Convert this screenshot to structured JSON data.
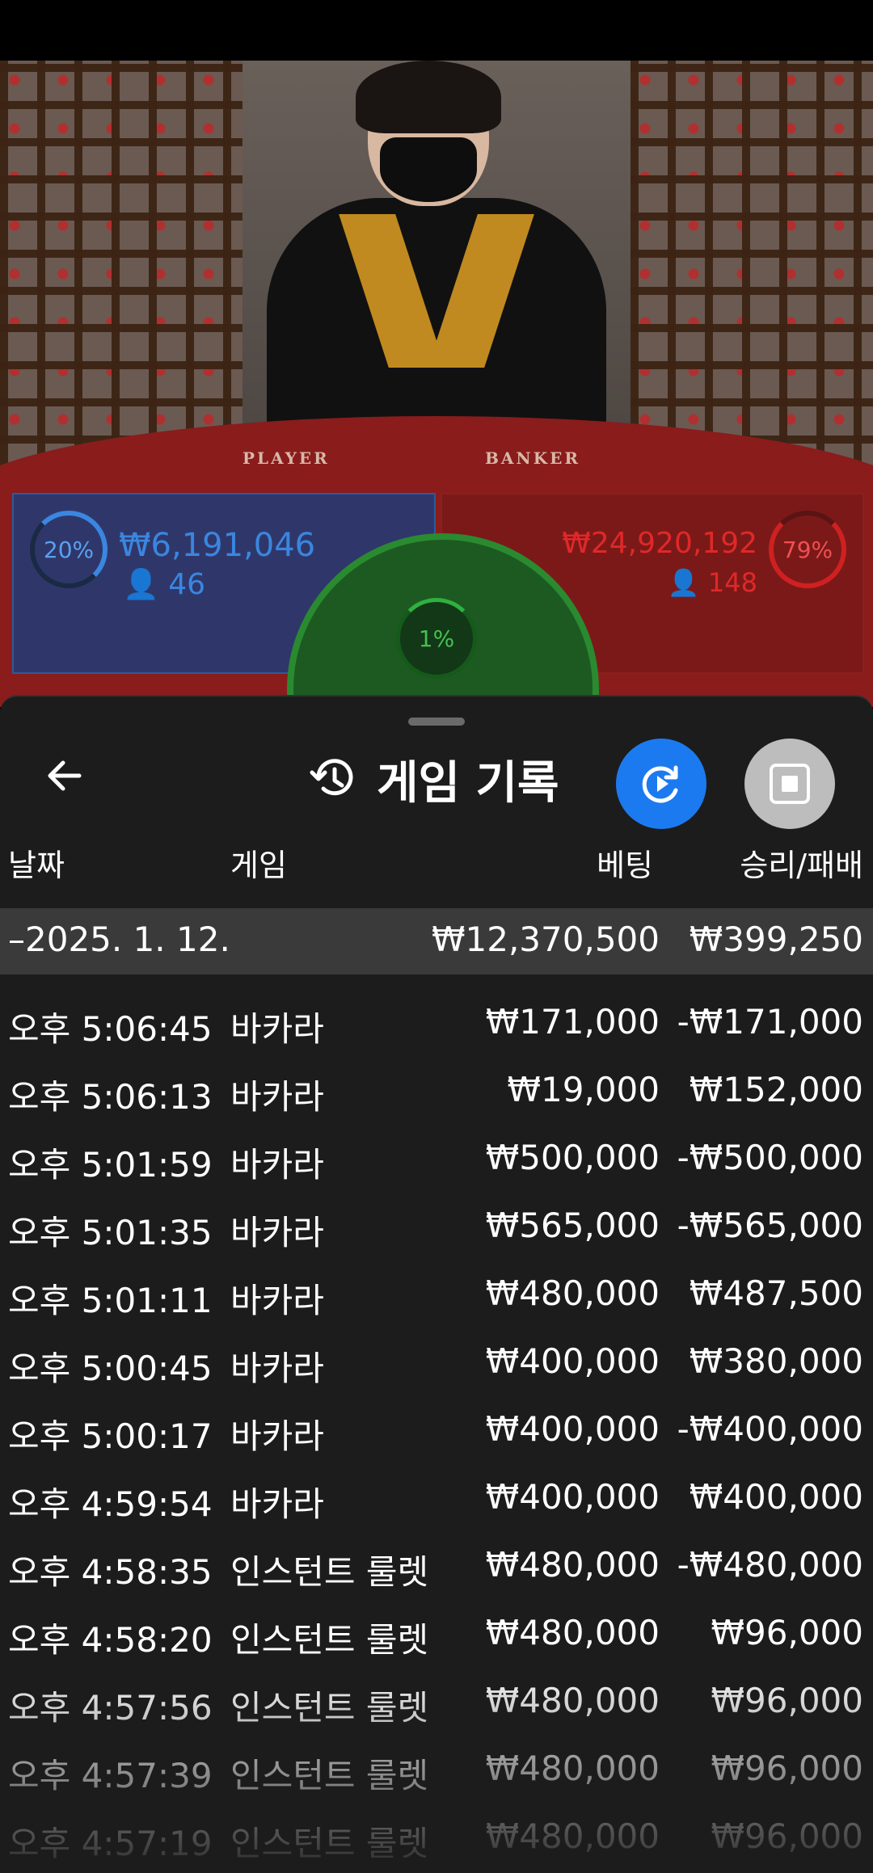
{
  "video": {
    "table_labels": {
      "player": "PLAYER",
      "banker": "BANKER"
    },
    "player_stats": {
      "percent": "20%",
      "amount": "₩6,191,046",
      "count": "46"
    },
    "banker_stats": {
      "percent": "79%",
      "amount": "₩24,920,192",
      "count": "148"
    },
    "tie_stats": {
      "percent": "1%"
    }
  },
  "sheet": {
    "title": "게임 기록",
    "columns": {
      "date": "날짜",
      "game": "게임",
      "bet": "베팅",
      "winloss": "승리/패배"
    },
    "summary": {
      "date": "–2025. 1. 12.",
      "bet": "₩12,370,500",
      "winloss": "₩399,250"
    },
    "rows": [
      {
        "time": "오후 5:06:45",
        "game": "바카라",
        "bet": "₩171,000",
        "winloss": "-₩171,000"
      },
      {
        "time": "오후 5:06:13",
        "game": "바카라",
        "bet": "₩19,000",
        "winloss": "₩152,000"
      },
      {
        "time": "오후 5:01:59",
        "game": "바카라",
        "bet": "₩500,000",
        "winloss": "-₩500,000"
      },
      {
        "time": "오후 5:01:35",
        "game": "바카라",
        "bet": "₩565,000",
        "winloss": "-₩565,000"
      },
      {
        "time": "오후 5:01:11",
        "game": "바카라",
        "bet": "₩480,000",
        "winloss": "₩487,500"
      },
      {
        "time": "오후 5:00:45",
        "game": "바카라",
        "bet": "₩400,000",
        "winloss": "₩380,000"
      },
      {
        "time": "오후 5:00:17",
        "game": "바카라",
        "bet": "₩400,000",
        "winloss": "-₩400,000"
      },
      {
        "time": "오후 4:59:54",
        "game": "바카라",
        "bet": "₩400,000",
        "winloss": "₩400,000"
      },
      {
        "time": "오후 4:58:35",
        "game": "인스턴트 룰렛",
        "bet": "₩480,000",
        "winloss": "-₩480,000"
      },
      {
        "time": "오후 4:58:20",
        "game": "인스턴트 룰렛",
        "bet": "₩480,000",
        "winloss": "₩96,000"
      },
      {
        "time": "오후 4:57:56",
        "game": "인스턴트 룰렛",
        "bet": "₩480,000",
        "winloss": "₩96,000"
      },
      {
        "time": "오후 4:57:39",
        "game": "인스턴트 룰렛",
        "bet": "₩480,000",
        "winloss": "₩96,000"
      },
      {
        "time": "오후 4:57:19",
        "game": "인스턴트 룰렛",
        "bet": "₩480,000",
        "winloss": "₩96,000"
      }
    ]
  },
  "icons": {
    "back": "arrow-left-icon",
    "history": "history-icon",
    "replay": "replay-icon",
    "stop": "stop-icon"
  },
  "colors": {
    "accent_blue": "#1c7af0",
    "banker_red": "#e02828",
    "player_blue": "#3a86e0",
    "tie_green": "#46c050",
    "sheet_bg": "#1c1c1c"
  }
}
